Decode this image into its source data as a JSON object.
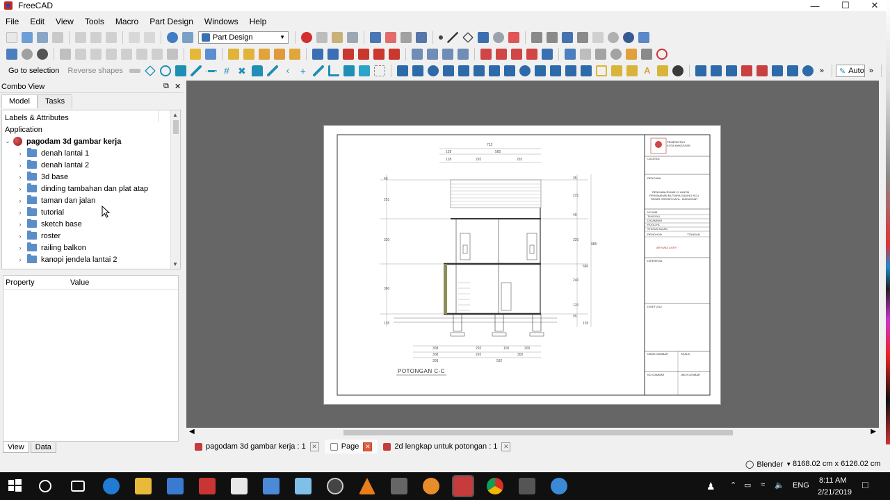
{
  "window": {
    "title": "FreeCAD"
  },
  "menu": [
    "File",
    "Edit",
    "View",
    "Tools",
    "Macro",
    "Part Design",
    "Windows",
    "Help"
  ],
  "toolbar": {
    "workbench": "Part Design",
    "go_to_selection": "Go to selection",
    "reverse_shapes": "Reverse shapes",
    "auto_label": "Auto"
  },
  "combo_view": {
    "title": "Combo View",
    "tabs": [
      "Model",
      "Tasks"
    ],
    "tree_header": "Labels & Attributes",
    "application": "Application",
    "document": "pagodam 3d gambar kerja",
    "items": [
      "denah lantai 1",
      "denah lantai 2",
      "3d base",
      "dinding tambahan dan plat atap",
      "taman dan jalan",
      "tutorial",
      "sketch base",
      "roster",
      "railing balkon",
      "kanopi jendela lantai 2"
    ],
    "property_headers": [
      "Property",
      "Value"
    ],
    "bottom_tabs": [
      "View",
      "Data"
    ]
  },
  "drawing": {
    "section_label": "POTONGAN C-C",
    "title_block": {
      "org_line1": "PEMERINTAH",
      "org_line2": "KOTA MAKASSAR",
      "catatan": "CATATAN",
      "rencana": "RENCANA",
      "project_lines": [
        "RENCANA RUMAH 2 LANTAI",
        "PERUMAHAN MUTIARA GADING NCU",
        "PASAR GROSIR DAYA - MAKASSAR"
      ],
      "fields": [
        "NO.IMB",
        "TANGGAL",
        "DIGAMBAR",
        "ROOLIYA",
        "STATUS JALAN",
        "PEMOHON"
      ],
      "signature": "ARYANDI ASRY",
      "diperiksa": "DIPERIKSA",
      "disetujui": "DISETUJUI",
      "nama_gambar": "NAMA GAMBAR",
      "skala": "SKALA",
      "no_gambar": "NO.GAMBAR",
      "jumlah": "JMLH.LEMBAR",
      "ttd": "TTANDAN"
    },
    "dims_top": [
      "712",
      "128",
      "585",
      "128",
      "292",
      "292"
    ],
    "dims_left": [
      "40",
      "251",
      "320",
      "360",
      "135"
    ],
    "dims_right": [
      "35",
      "221",
      "40",
      "320",
      "240",
      "120",
      "95",
      "135",
      "985",
      "680"
    ],
    "dims_bottom": [
      "308",
      "292",
      "100",
      "200",
      "308",
      "292",
      "300",
      "308",
      "592"
    ]
  },
  "doc_tabs": [
    {
      "label": "pagodam 3d gambar kerja : 1",
      "active": false
    },
    {
      "label": "Page",
      "active": true
    },
    {
      "label": "2d lengkap untuk potongan : 1",
      "active": false
    }
  ],
  "status": {
    "nav_style": "Blender",
    "dimensions": "8168.02 cm x 6126.02 cm"
  },
  "taskbar": {
    "lang": "ENG",
    "time": "8:11 AM",
    "date": "2/21/2019"
  },
  "colors": {
    "mdi_bg": "#666666",
    "folder": "#5b8ec9",
    "taskbar": "#101010",
    "record": "#d32f2f"
  }
}
